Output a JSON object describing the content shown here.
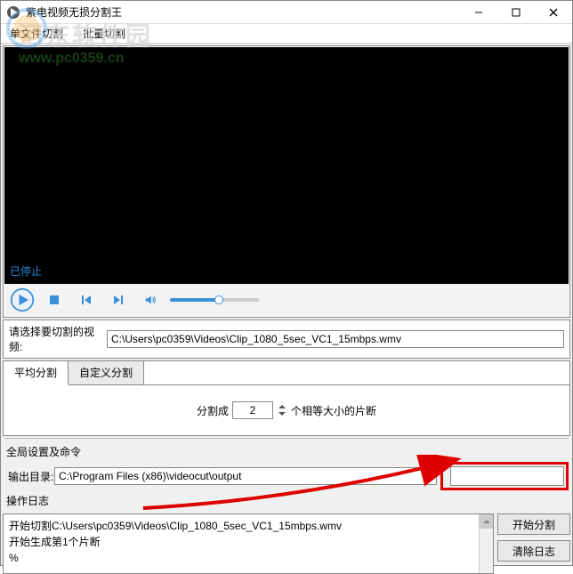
{
  "window": {
    "title": "紫电视频无损分割王"
  },
  "menubar": {
    "items": [
      "单文件切割",
      "批量切割"
    ]
  },
  "watermark": {
    "line1": "河东软件园",
    "line2": "www.pc0359.cn"
  },
  "video": {
    "status": "已停止"
  },
  "controls": {
    "play": "play-icon",
    "stop": "stop-icon",
    "prev": "prev-icon",
    "next": "next-icon",
    "volume": "volume-icon"
  },
  "select_row": {
    "label": "请选择要切割的视频:",
    "value": "C:\\Users\\pc0359\\Videos\\Clip_1080_5sec_VC1_15mbps.wmv"
  },
  "tabs": {
    "items": [
      "平均分割",
      "自定义分割"
    ],
    "active": 0,
    "split_label_left": "分割成",
    "split_count": "2",
    "split_label_right": "个相等大小的片断"
  },
  "global_section": {
    "label": "全局设置及命令"
  },
  "outdir": {
    "label": "输出目录:",
    "value": "C:\\Program Files (x86)\\videocut\\output"
  },
  "log": {
    "label": "操作日志",
    "lines": [
      "开始切割C:\\Users\\pc0359\\Videos\\Clip_1080_5sec_VC1_15mbps.wmv",
      "开始生成第1个片断",
      "%"
    ]
  },
  "buttons": {
    "start": "开始分割",
    "clear": "清除日志"
  }
}
